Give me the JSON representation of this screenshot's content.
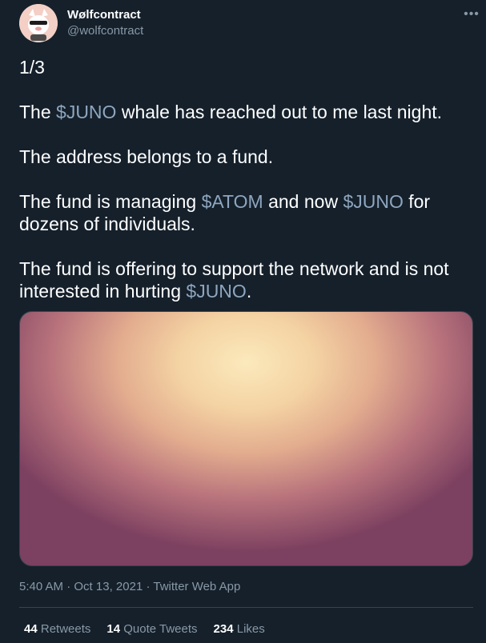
{
  "author": {
    "display_name": "Wølfcontract",
    "handle": "@wolfcontract",
    "avatar": "wolf-avatar-icon"
  },
  "more_icon": "more-icon",
  "more_glyph": "•••",
  "tweet": {
    "line1": "1/3",
    "line2_pre": "The ",
    "line2_tag": "$JUNO",
    "line2_post": " whale has reached out to me last night.",
    "line3": "The address belongs to a fund.",
    "line4_pre": "The fund is managing ",
    "line4_tag1": "$ATOM",
    "line4_mid": " and now ",
    "line4_tag2": "$JUNO",
    "line4_post": " for dozens of individuals.",
    "line5_pre": "The fund is offering to support the network and is not interested in hurting ",
    "line5_tag": "$JUNO",
    "line5_post": "."
  },
  "meta": {
    "time": "5:40 AM",
    "sep1": " · ",
    "date": "Oct 13, 2021",
    "sep2": " · ",
    "source": "Twitter Web App"
  },
  "stats": {
    "retweets_count": "44",
    "retweets_label": " Retweets",
    "quotes_count": "14",
    "quotes_label": " Quote Tweets",
    "likes_count": "234",
    "likes_label": " Likes"
  },
  "colors": {
    "background": "#15202b",
    "cashtag": "#8ea6bf",
    "secondary_text": "#8899a6",
    "border": "#38444d"
  }
}
